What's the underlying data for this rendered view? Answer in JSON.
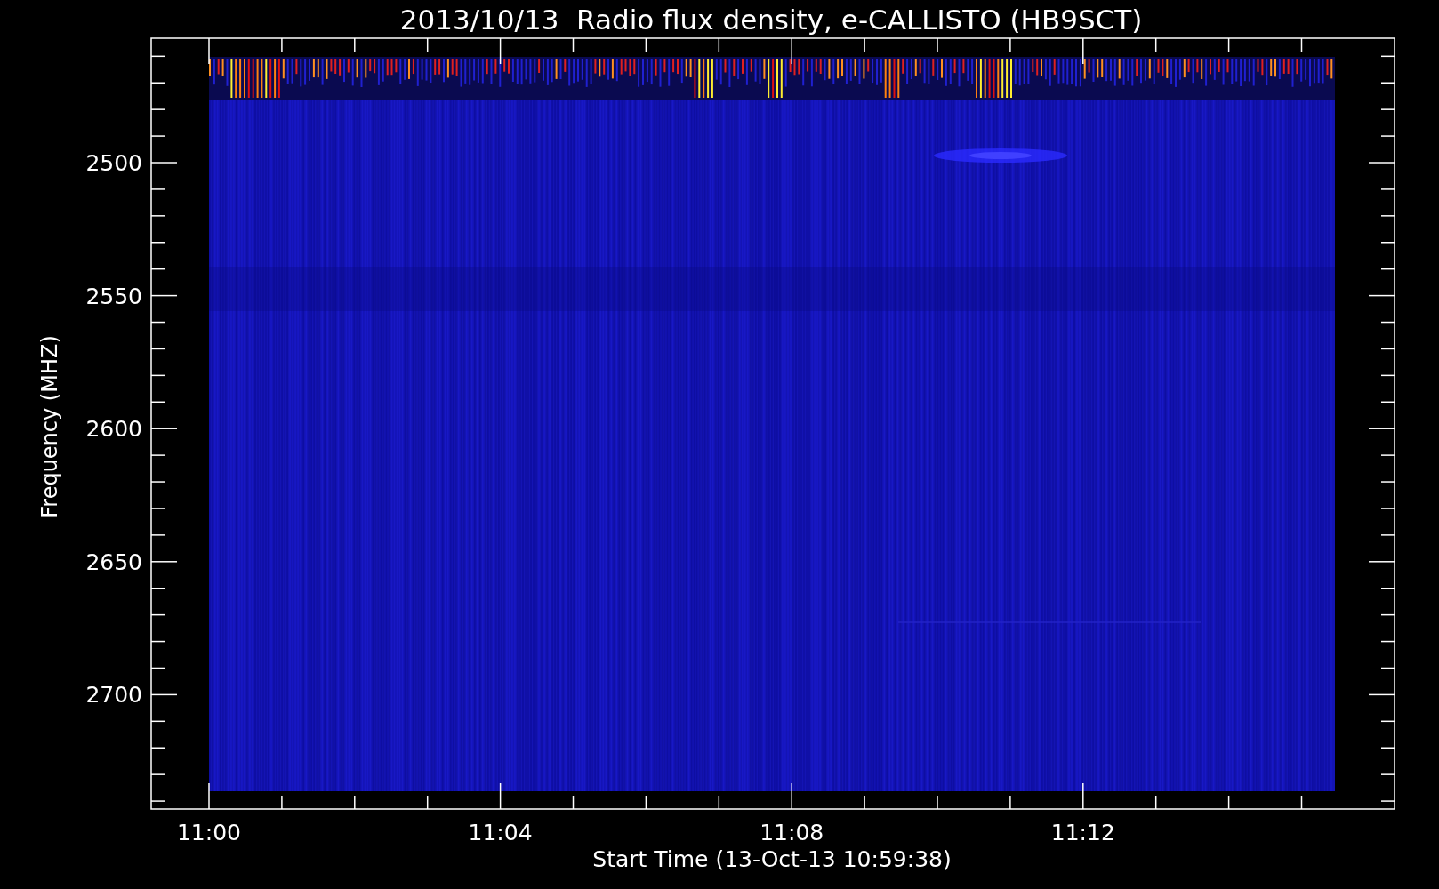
{
  "title": "2013/10/13  Radio flux density, e-CALLISTO (HB9SCT)",
  "y_axis": {
    "label": "Frequency (MHZ)",
    "ticks": [
      "2500",
      "2550",
      "2600",
      "2650",
      "2700"
    ]
  },
  "x_axis": {
    "label": "Start Time (13-Oct-13 10:59:38)",
    "ticks": [
      "11:00",
      "11:04",
      "11:08",
      "11:12"
    ]
  }
}
